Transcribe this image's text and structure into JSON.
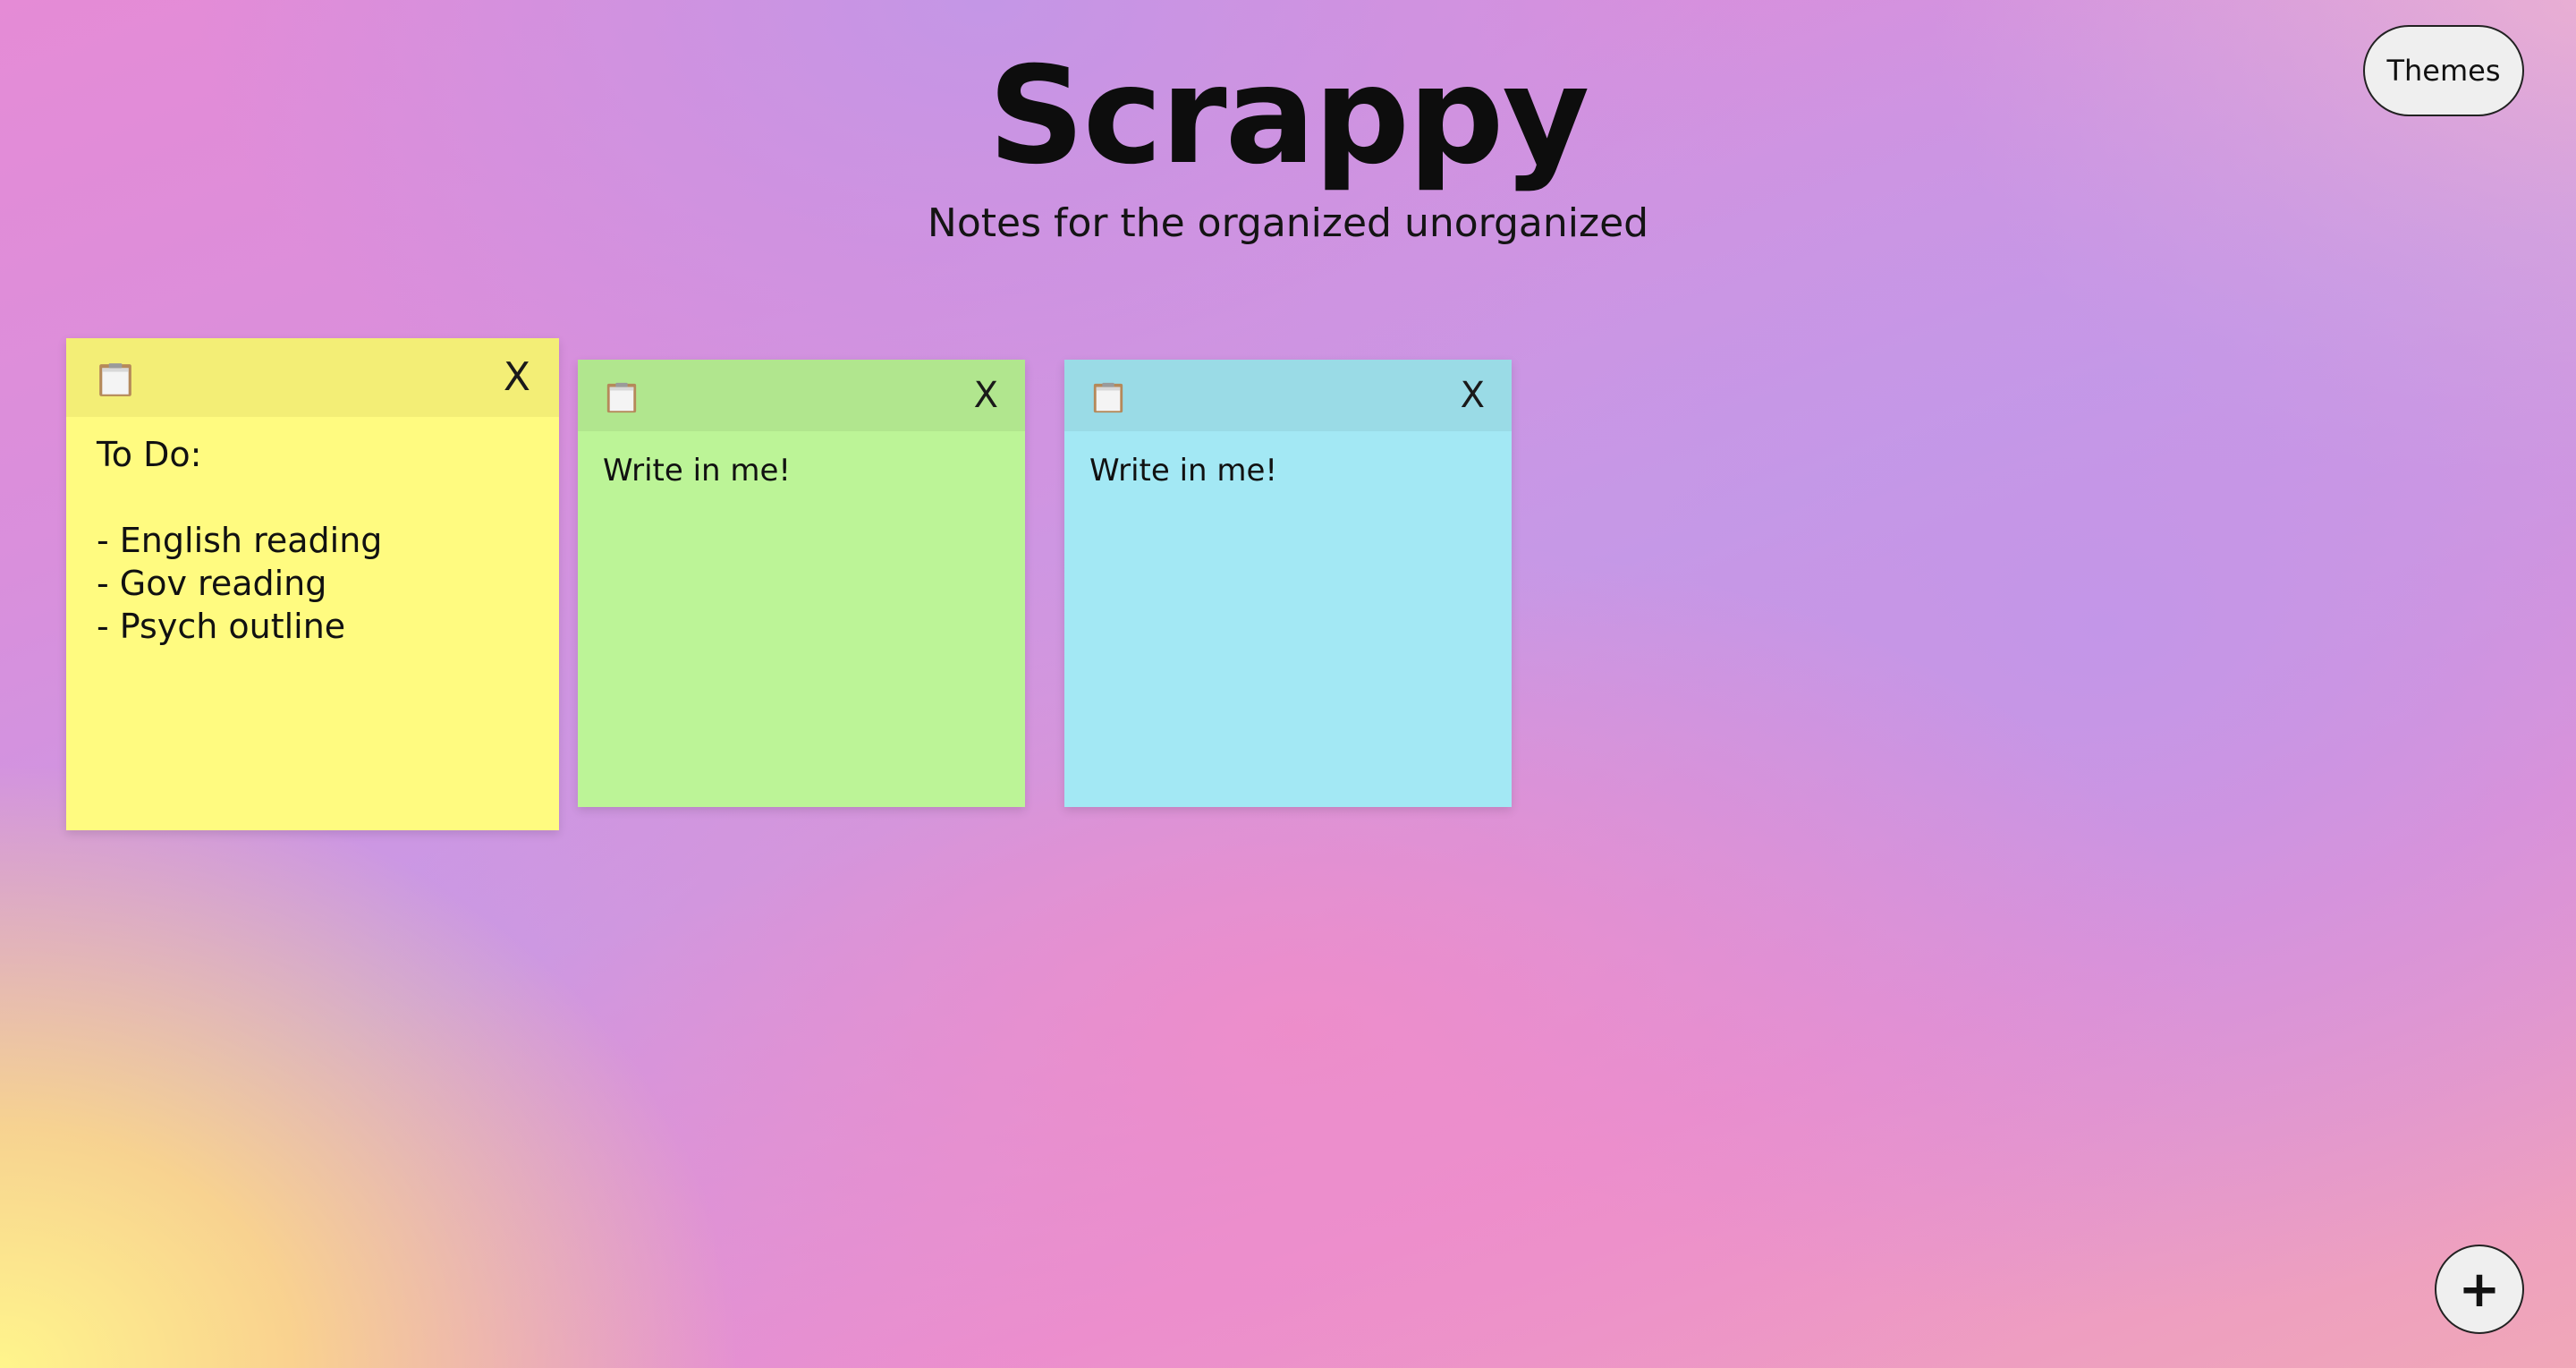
{
  "app": {
    "title": "Scrappy",
    "subtitle": "Notes for the organized unorganized"
  },
  "themes_button": {
    "label": "Themes"
  },
  "add_button": {
    "label": "+"
  },
  "notes": [
    {
      "color": "#fffb80",
      "header_color": "#f3ee76",
      "icon": "clipboard-icon",
      "close_label": "X",
      "text": "To Do:\n\n- English reading\n- Gov reading\n- Psych outline"
    },
    {
      "color": "#bcf497",
      "header_color": "#b1e68e",
      "icon": "clipboard-icon",
      "close_label": "X",
      "text": "Write in me!"
    },
    {
      "color": "#a3e8f4",
      "header_color": "#9adbe6",
      "icon": "clipboard-icon",
      "close_label": "X",
      "text": "Write in me!"
    }
  ]
}
